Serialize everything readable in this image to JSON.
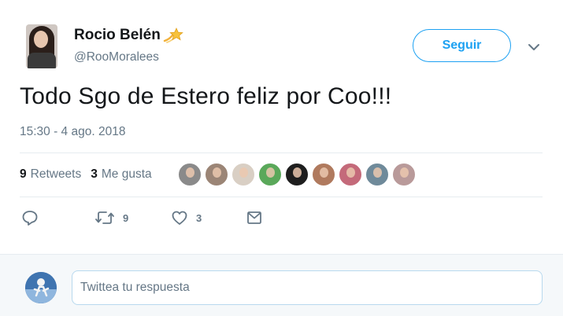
{
  "user": {
    "display_name": "Rocio Belén",
    "handle": "@RooMoralees",
    "badge_icon": "shooting-star-icon"
  },
  "follow_button": {
    "label": "Seguir"
  },
  "menu": {
    "icon": "chevron-down-icon"
  },
  "tweet": {
    "text": "Todo Sgo de Estero feliz por Coo!!!",
    "timestamp": "15:30 - 4 ago. 2018"
  },
  "stats": {
    "retweets_count": "9",
    "retweets_label": "Retweets",
    "likes_count": "3",
    "likes_label": "Me gusta"
  },
  "likers": [
    {
      "color": "#8a8a8a"
    },
    {
      "color": "#9b8576"
    },
    {
      "color": "#d9cfc4"
    },
    {
      "color": "#5aa85a"
    },
    {
      "color": "#1e1e1e"
    },
    {
      "color": "#b07a5e"
    },
    {
      "color": "#c46a7a"
    },
    {
      "color": "#6f8a9a"
    },
    {
      "color": "#b99a9a"
    }
  ],
  "actions": {
    "reply_icon": "reply-icon",
    "retweet_icon": "retweet-icon",
    "retweet_count": "9",
    "like_icon": "heart-icon",
    "like_count": "3",
    "dm_icon": "envelope-icon"
  },
  "reply_box": {
    "placeholder": "Twittea tu respuesta"
  },
  "colors": {
    "accent": "#1da1f2",
    "secondary_text": "#657786",
    "divider": "#e6ecf0",
    "reply_bg": "#f5f8fa"
  }
}
